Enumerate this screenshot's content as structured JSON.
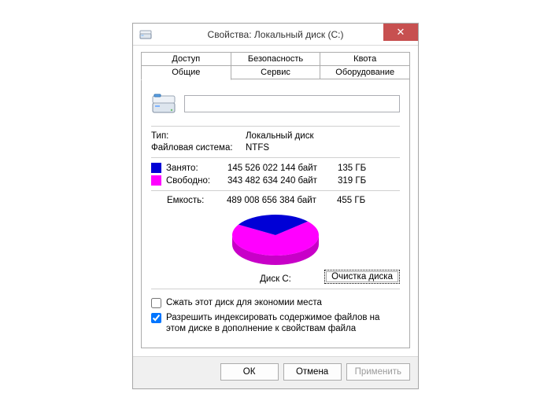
{
  "window": {
    "title": "Свойства: Локальный диск (C:)",
    "close_glyph": "✕"
  },
  "tabs": {
    "row_top": [
      "Доступ",
      "Безопасность",
      "Квота"
    ],
    "row_bottom": [
      "Общие",
      "Сервис",
      "Оборудование"
    ],
    "active": "Общие"
  },
  "general": {
    "name_value": "",
    "type_label": "Тип:",
    "type_value": "Локальный диск",
    "fs_label": "Файловая система:",
    "fs_value": "NTFS",
    "used_label": "Занято:",
    "used_bytes": "145 526 022 144 байт",
    "used_gb": "135 ГБ",
    "free_label": "Свободно:",
    "free_bytes": "343 482 634 240 байт",
    "free_gb": "319 ГБ",
    "capacity_label": "Емкость:",
    "capacity_bytes": "489 008 656 384 байт",
    "capacity_gb": "455 ГБ",
    "disk_label": "Диск C:",
    "cleanup_label": "Очистка диска",
    "compress_label": "Сжать этот диск для экономии места",
    "compress_checked": false,
    "index_label": "Разрешить индексировать содержимое файлов на этом диске в дополнение к свойствам файла",
    "index_checked": true
  },
  "colors": {
    "used": "#0000d6",
    "free": "#ff00ff",
    "side": "#c800c8",
    "used_side": "#000099"
  },
  "footer": {
    "ok": "ОК",
    "cancel": "Отмена",
    "apply": "Применить"
  },
  "chart_data": {
    "type": "pie",
    "title": "Диск C:",
    "series": [
      {
        "name": "Занято",
        "value_bytes": 145526022144,
        "value_gb": 135,
        "color": "#0000d6"
      },
      {
        "name": "Свободно",
        "value_bytes": 343482634240,
        "value_gb": 319,
        "color": "#ff00ff"
      }
    ],
    "total_bytes": 489008656384,
    "total_gb": 455,
    "used_fraction": 0.2976
  }
}
